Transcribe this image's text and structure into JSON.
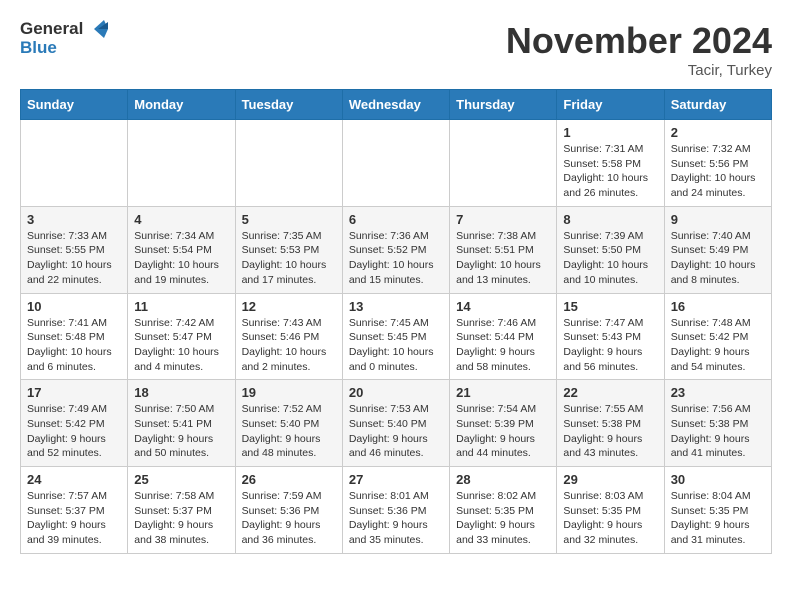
{
  "header": {
    "logo_general": "General",
    "logo_blue": "Blue",
    "month_title": "November 2024",
    "location": "Tacir, Turkey"
  },
  "days_of_week": [
    "Sunday",
    "Monday",
    "Tuesday",
    "Wednesday",
    "Thursday",
    "Friday",
    "Saturday"
  ],
  "weeks": [
    [
      {
        "day": "",
        "info": ""
      },
      {
        "day": "",
        "info": ""
      },
      {
        "day": "",
        "info": ""
      },
      {
        "day": "",
        "info": ""
      },
      {
        "day": "",
        "info": ""
      },
      {
        "day": "1",
        "info": "Sunrise: 7:31 AM\nSunset: 5:58 PM\nDaylight: 10 hours and 26 minutes."
      },
      {
        "day": "2",
        "info": "Sunrise: 7:32 AM\nSunset: 5:56 PM\nDaylight: 10 hours and 24 minutes."
      }
    ],
    [
      {
        "day": "3",
        "info": "Sunrise: 7:33 AM\nSunset: 5:55 PM\nDaylight: 10 hours and 22 minutes."
      },
      {
        "day": "4",
        "info": "Sunrise: 7:34 AM\nSunset: 5:54 PM\nDaylight: 10 hours and 19 minutes."
      },
      {
        "day": "5",
        "info": "Sunrise: 7:35 AM\nSunset: 5:53 PM\nDaylight: 10 hours and 17 minutes."
      },
      {
        "day": "6",
        "info": "Sunrise: 7:36 AM\nSunset: 5:52 PM\nDaylight: 10 hours and 15 minutes."
      },
      {
        "day": "7",
        "info": "Sunrise: 7:38 AM\nSunset: 5:51 PM\nDaylight: 10 hours and 13 minutes."
      },
      {
        "day": "8",
        "info": "Sunrise: 7:39 AM\nSunset: 5:50 PM\nDaylight: 10 hours and 10 minutes."
      },
      {
        "day": "9",
        "info": "Sunrise: 7:40 AM\nSunset: 5:49 PM\nDaylight: 10 hours and 8 minutes."
      }
    ],
    [
      {
        "day": "10",
        "info": "Sunrise: 7:41 AM\nSunset: 5:48 PM\nDaylight: 10 hours and 6 minutes."
      },
      {
        "day": "11",
        "info": "Sunrise: 7:42 AM\nSunset: 5:47 PM\nDaylight: 10 hours and 4 minutes."
      },
      {
        "day": "12",
        "info": "Sunrise: 7:43 AM\nSunset: 5:46 PM\nDaylight: 10 hours and 2 minutes."
      },
      {
        "day": "13",
        "info": "Sunrise: 7:45 AM\nSunset: 5:45 PM\nDaylight: 10 hours and 0 minutes."
      },
      {
        "day": "14",
        "info": "Sunrise: 7:46 AM\nSunset: 5:44 PM\nDaylight: 9 hours and 58 minutes."
      },
      {
        "day": "15",
        "info": "Sunrise: 7:47 AM\nSunset: 5:43 PM\nDaylight: 9 hours and 56 minutes."
      },
      {
        "day": "16",
        "info": "Sunrise: 7:48 AM\nSunset: 5:42 PM\nDaylight: 9 hours and 54 minutes."
      }
    ],
    [
      {
        "day": "17",
        "info": "Sunrise: 7:49 AM\nSunset: 5:42 PM\nDaylight: 9 hours and 52 minutes."
      },
      {
        "day": "18",
        "info": "Sunrise: 7:50 AM\nSunset: 5:41 PM\nDaylight: 9 hours and 50 minutes."
      },
      {
        "day": "19",
        "info": "Sunrise: 7:52 AM\nSunset: 5:40 PM\nDaylight: 9 hours and 48 minutes."
      },
      {
        "day": "20",
        "info": "Sunrise: 7:53 AM\nSunset: 5:40 PM\nDaylight: 9 hours and 46 minutes."
      },
      {
        "day": "21",
        "info": "Sunrise: 7:54 AM\nSunset: 5:39 PM\nDaylight: 9 hours and 44 minutes."
      },
      {
        "day": "22",
        "info": "Sunrise: 7:55 AM\nSunset: 5:38 PM\nDaylight: 9 hours and 43 minutes."
      },
      {
        "day": "23",
        "info": "Sunrise: 7:56 AM\nSunset: 5:38 PM\nDaylight: 9 hours and 41 minutes."
      }
    ],
    [
      {
        "day": "24",
        "info": "Sunrise: 7:57 AM\nSunset: 5:37 PM\nDaylight: 9 hours and 39 minutes."
      },
      {
        "day": "25",
        "info": "Sunrise: 7:58 AM\nSunset: 5:37 PM\nDaylight: 9 hours and 38 minutes."
      },
      {
        "day": "26",
        "info": "Sunrise: 7:59 AM\nSunset: 5:36 PM\nDaylight: 9 hours and 36 minutes."
      },
      {
        "day": "27",
        "info": "Sunrise: 8:01 AM\nSunset: 5:36 PM\nDaylight: 9 hours and 35 minutes."
      },
      {
        "day": "28",
        "info": "Sunrise: 8:02 AM\nSunset: 5:35 PM\nDaylight: 9 hours and 33 minutes."
      },
      {
        "day": "29",
        "info": "Sunrise: 8:03 AM\nSunset: 5:35 PM\nDaylight: 9 hours and 32 minutes."
      },
      {
        "day": "30",
        "info": "Sunrise: 8:04 AM\nSunset: 5:35 PM\nDaylight: 9 hours and 31 minutes."
      }
    ]
  ]
}
